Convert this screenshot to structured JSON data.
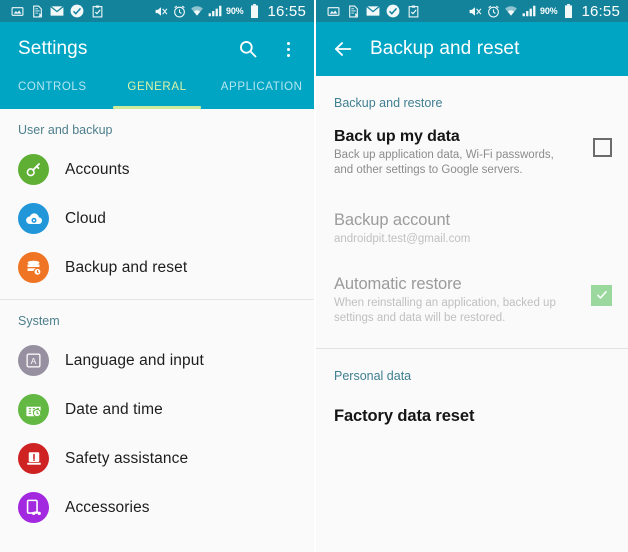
{
  "status_bar": {
    "icons": [
      "image-icon",
      "document-blocked-icon",
      "envelope-icon",
      "check-circle-icon",
      "clipboard-check-icon",
      "mute-icon",
      "alarm-icon",
      "wifi-icon",
      "signal-icon"
    ],
    "battery_percent": "90%",
    "battery_icon": "battery-icon",
    "time": "16:55"
  },
  "left_screen": {
    "appbar": {
      "title": "Settings",
      "search_icon": "search-icon",
      "overflow_icon": "overflow-menu-icon"
    },
    "tabs": [
      {
        "label": "CONTROLS",
        "active": false
      },
      {
        "label": "GENERAL",
        "active": true
      },
      {
        "label": "APPLICATION",
        "active": false
      }
    ],
    "sections": [
      {
        "header": "User and backup",
        "items": [
          {
            "label": "Accounts",
            "icon": "key-icon",
            "color": "#5faf35"
          },
          {
            "label": "Cloud",
            "icon": "cloud-sync-icon",
            "color": "#2196d9"
          },
          {
            "label": "Backup and reset",
            "icon": "database-restore-icon",
            "color": "#ef7524"
          }
        ]
      },
      {
        "header": "System",
        "items": [
          {
            "label": "Language and input",
            "icon": "letter-a-icon",
            "color": "#9690a0"
          },
          {
            "label": "Date and time",
            "icon": "calendar-clock-icon",
            "color": "#62b843"
          },
          {
            "label": "Safety assistance",
            "icon": "warning-icon",
            "color": "#cf2222"
          },
          {
            "label": "Accessories",
            "icon": "headset-device-icon",
            "color": "#a329e0"
          }
        ]
      }
    ]
  },
  "right_screen": {
    "appbar": {
      "title": "Backup and reset",
      "back_icon": "back-arrow-icon"
    },
    "section_backup": {
      "header": "Backup and restore",
      "items": [
        {
          "title": "Back up my data",
          "subtitle": "Back up application data, Wi-Fi passwords, and other settings to Google servers.",
          "checked": false,
          "dim": false
        },
        {
          "title": "Backup account",
          "subtitle": "androidpit.test@gmail.com",
          "checked": null,
          "dim": true
        },
        {
          "title": "Automatic restore",
          "subtitle": "When reinstalling an application, backed up settings and data will be restored.",
          "checked": true,
          "dim": true
        }
      ]
    },
    "section_personal": {
      "header": "Personal data",
      "items": [
        {
          "title": "Factory data reset"
        }
      ]
    }
  },
  "colors": {
    "status_bar": "#13839b",
    "app_bar": "#00a5c4",
    "tab_active": "#ddf3a8",
    "tab_indicator": "#cdeb9a",
    "checkbox_checked": "#9ad89d",
    "section_header": "#4d7f8c"
  }
}
